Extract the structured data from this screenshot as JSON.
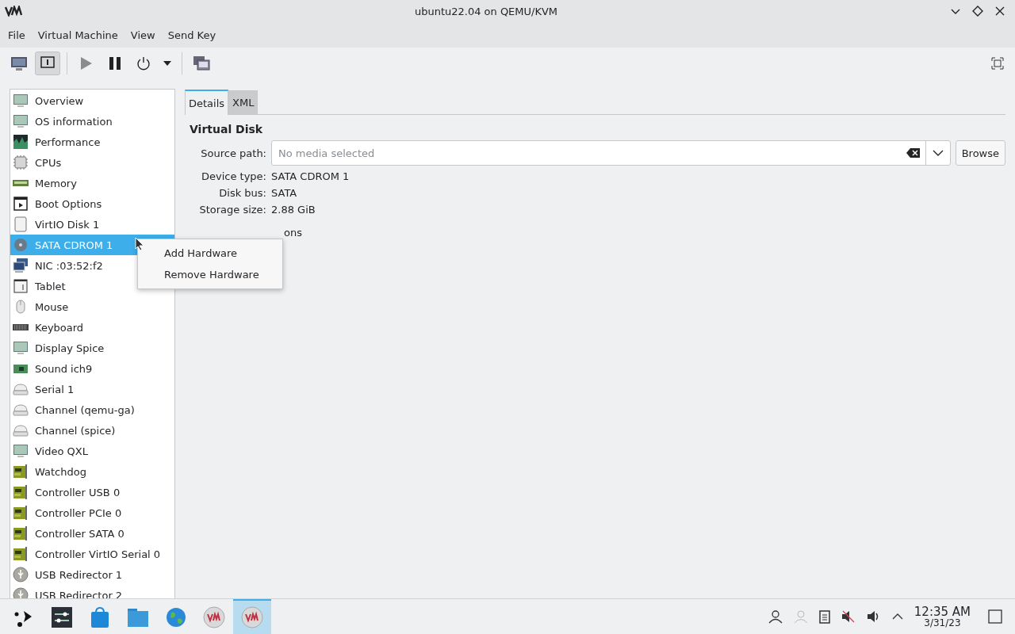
{
  "window": {
    "title": "ubuntu22.04 on QEMU/KVM"
  },
  "menu_bar": [
    "File",
    "Virtual Machine",
    "View",
    "Send Key"
  ],
  "toolbar": [
    {
      "kind": "console",
      "selected": false
    },
    {
      "kind": "details",
      "selected": true
    },
    {
      "kind": "run",
      "selected": false
    },
    {
      "kind": "pause",
      "selected": false
    },
    {
      "kind": "power",
      "selected": false
    },
    {
      "kind": "dropdown",
      "selected": false
    },
    {
      "kind": "snapshots",
      "selected": false
    }
  ],
  "sidebar": {
    "items": [
      {
        "label": "Overview",
        "kind": "monitor",
        "selected": false
      },
      {
        "label": "OS information",
        "kind": "monitor",
        "selected": false
      },
      {
        "label": "Performance",
        "kind": "chart",
        "selected": false
      },
      {
        "label": "CPUs",
        "kind": "chip",
        "selected": false
      },
      {
        "label": "Memory",
        "kind": "memory",
        "selected": false
      },
      {
        "label": "Boot Options",
        "kind": "boot",
        "selected": false
      },
      {
        "label": "VirtIO Disk 1",
        "kind": "disk",
        "selected": false
      },
      {
        "label": "SATA CDROM 1",
        "kind": "cdrom",
        "selected": true
      },
      {
        "label": "NIC :03:52:f2",
        "kind": "nic",
        "selected": false
      },
      {
        "label": "Tablet",
        "kind": "tablet",
        "selected": false
      },
      {
        "label": "Mouse",
        "kind": "mouse",
        "selected": false
      },
      {
        "label": "Keyboard",
        "kind": "keyboard",
        "selected": false
      },
      {
        "label": "Display Spice",
        "kind": "monitor",
        "selected": false
      },
      {
        "label": "Sound ich9",
        "kind": "sound",
        "selected": false
      },
      {
        "label": "Serial 1",
        "kind": "serial",
        "selected": false
      },
      {
        "label": "Channel (qemu-ga)",
        "kind": "serial",
        "selected": false
      },
      {
        "label": "Channel (spice)",
        "kind": "serial",
        "selected": false
      },
      {
        "label": "Video QXL",
        "kind": "monitor",
        "selected": false
      },
      {
        "label": "Watchdog",
        "kind": "card",
        "selected": false
      },
      {
        "label": "Controller USB 0",
        "kind": "card",
        "selected": false
      },
      {
        "label": "Controller PCIe 0",
        "kind": "card",
        "selected": false
      },
      {
        "label": "Controller SATA 0",
        "kind": "card",
        "selected": false
      },
      {
        "label": "Controller VirtIO Serial 0",
        "kind": "card",
        "selected": false
      },
      {
        "label": "USB Redirector 1",
        "kind": "usb",
        "selected": false
      },
      {
        "label": "USB Redirector 2",
        "kind": "usb",
        "selected": false
      }
    ]
  },
  "tabs": [
    {
      "label": "Details",
      "selected": true
    },
    {
      "label": "XML",
      "selected": false
    }
  ],
  "details": {
    "heading": "Virtual Disk",
    "source_path": {
      "label": "Source path:",
      "placeholder": "No media selected",
      "button": "Browse"
    },
    "fields": [
      {
        "label": "Device type:",
        "value": "SATA CDROM 1"
      },
      {
        "label": "Disk bus:",
        "value": "SATA"
      },
      {
        "label": "Storage size:",
        "value": "2.88 GiB"
      }
    ],
    "expander_visible_text": "ons"
  },
  "context_menu": [
    "Add Hardware",
    "Remove Hardware"
  ],
  "taskbar": {
    "apps": [
      {
        "kind": "launcher",
        "active": false
      },
      {
        "kind": "settings",
        "active": false
      },
      {
        "kind": "store",
        "active": false
      },
      {
        "kind": "files",
        "active": false
      },
      {
        "kind": "browser",
        "active": false
      },
      {
        "kind": "vm",
        "active": false
      },
      {
        "kind": "vm",
        "active": true
      }
    ],
    "clock": {
      "time": "12:35 AM",
      "date": "3/31/23"
    }
  }
}
